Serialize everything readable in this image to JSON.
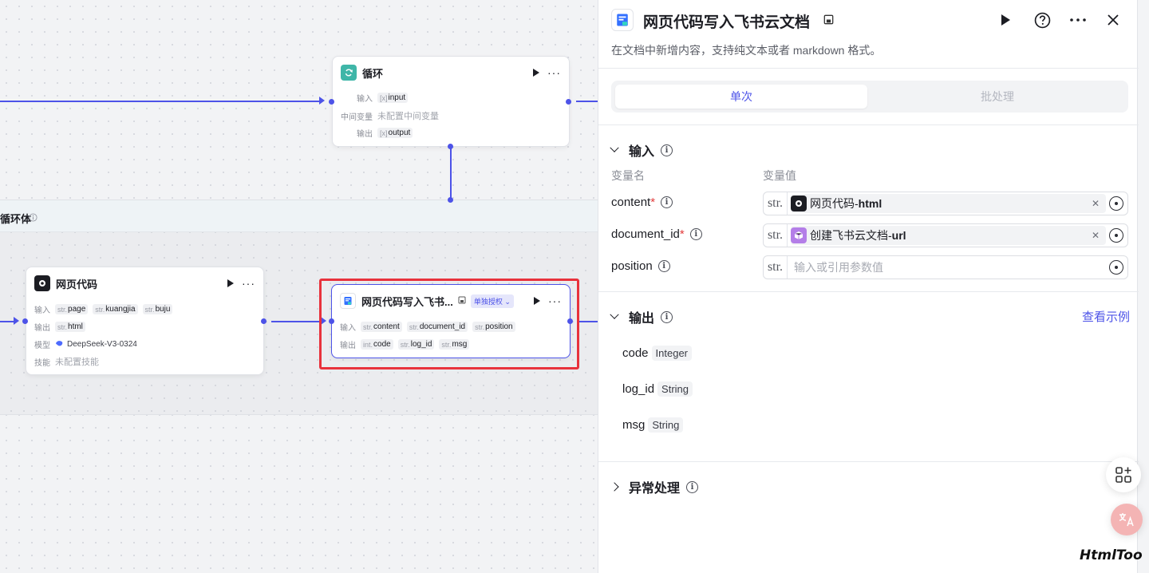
{
  "canvas": {
    "loop_body": {
      "title": "循环体"
    },
    "loop_node": {
      "title": "循环",
      "input_label": "输入",
      "input_tag": {
        "type": "[x]",
        "name": "input"
      },
      "var_label": "中间变量",
      "var_value": "未配置中间变量",
      "output_label": "输出",
      "output_tag": {
        "type": "[x]",
        "name": "output"
      }
    },
    "web_node": {
      "title": "网页代码",
      "input_label": "输入",
      "inputs": [
        {
          "type": "str.",
          "name": "page"
        },
        {
          "type": "str.",
          "name": "kuangjia"
        },
        {
          "type": "str.",
          "name": "buju"
        }
      ],
      "output_label": "输出",
      "outputs": [
        {
          "type": "str.",
          "name": "html"
        }
      ],
      "model_label": "模型",
      "model_value": "DeepSeek-V3-0324",
      "skill_label": "技能",
      "skill_value": "未配置技能"
    },
    "doc_node": {
      "title": "网页代码写入飞书...",
      "auth_badge": "单独授权",
      "input_label": "输入",
      "inputs": [
        {
          "type": "str.",
          "name": "content"
        },
        {
          "type": "str.",
          "name": "document_id"
        },
        {
          "type": "str.",
          "name": "position"
        }
      ],
      "output_label": "输出",
      "outputs": [
        {
          "type": "int.",
          "name": "code"
        },
        {
          "type": "str.",
          "name": "log_id"
        },
        {
          "type": "str.",
          "name": "msg"
        }
      ],
      "highlight_color": "#e8323c"
    }
  },
  "panel": {
    "title": "网页代码写入飞书云文档",
    "description": "在文档中新增内容，支持纯文本或者 markdown 格式。",
    "tabs": [
      "单次",
      "批处理"
    ],
    "input_section": {
      "title": "输入",
      "col_name": "变量名",
      "col_value": "变量值",
      "params": [
        {
          "name": "content",
          "required": "*",
          "type": "str.",
          "ref_node": "网页代码",
          "ref_sep": " - ",
          "ref_field": "html"
        },
        {
          "name": "document_id",
          "required": "*",
          "type": "str.",
          "ref_node": "创建飞书云文档",
          "ref_sep": " - ",
          "ref_field": "url"
        },
        {
          "name": "position",
          "required": "",
          "type": "str.",
          "placeholder": "输入或引用参数值"
        }
      ]
    },
    "output_section": {
      "title": "输出",
      "view_example": "查看示例",
      "items": [
        {
          "name": "code",
          "type": "Integer"
        },
        {
          "name": "log_id",
          "type": "String"
        },
        {
          "name": "msg",
          "type": "String"
        }
      ]
    },
    "exception_section": {
      "title": "异常处理"
    }
  },
  "watermark": "HtmlToo",
  "colors": {
    "accent": "#4d53e8",
    "required": "#e23b3b"
  }
}
